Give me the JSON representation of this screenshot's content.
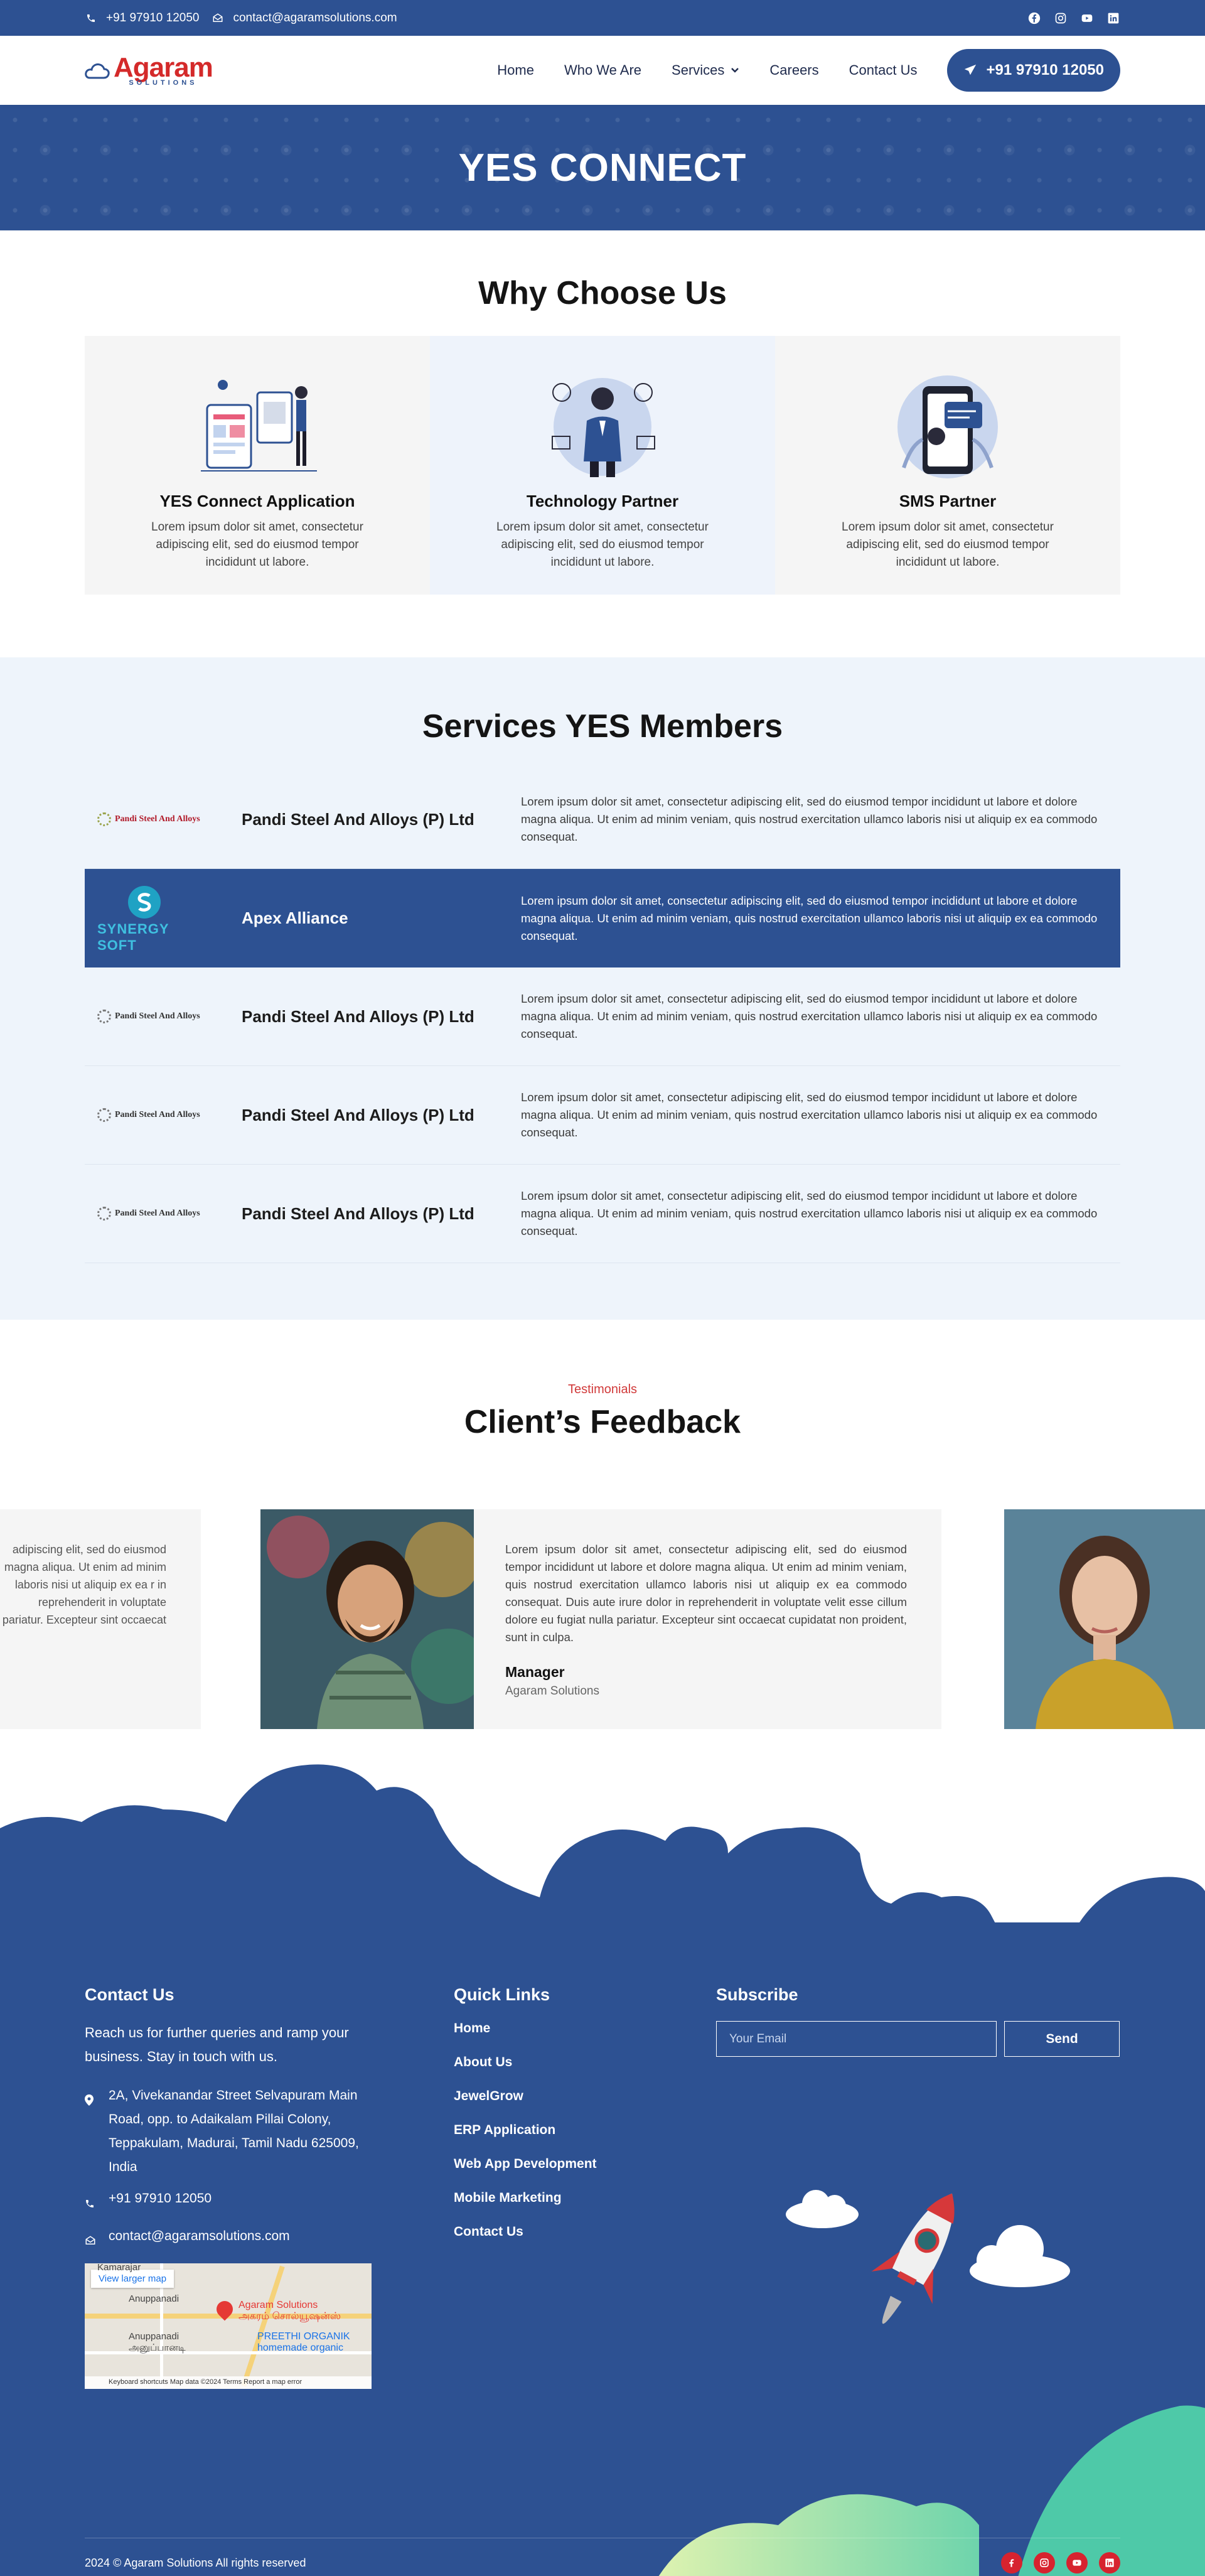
{
  "topbar": {
    "phone": "+91 97910 12050",
    "email": "contact@agaramsolutions.com",
    "social_icons": [
      "facebook-icon",
      "instagram-icon",
      "youtube-icon",
      "linkedin-icon"
    ]
  },
  "header": {
    "logo_text": "Agaram",
    "logo_sub": "SOLUTIONS",
    "nav": [
      "Home",
      "Who We Are",
      "Services",
      "Careers",
      "Contact Us"
    ],
    "phone_button": "+91 97910 12050"
  },
  "banner": {
    "title": "YES CONNECT"
  },
  "why": {
    "title": "Why Choose Us",
    "cards": [
      {
        "title": "YES Connect Application",
        "text": "Lorem ipsum dolor sit amet, consectetur adipiscing elit, sed do eiusmod tempor incididunt ut labore."
      },
      {
        "title": "Technology Partner",
        "text": "Lorem ipsum dolor sit amet, consectetur adipiscing elit, sed do eiusmod tempor incididunt ut labore."
      },
      {
        "title": "SMS Partner",
        "text": "Lorem ipsum dolor sit amet, consectetur adipiscing elit, sed do eiusmod tempor incididunt ut labore."
      }
    ]
  },
  "services": {
    "title": "Services YES Members",
    "rows": [
      {
        "name": "Pandi Steel And Alloys (P) Ltd",
        "logo": "Pandi Steel And Alloys",
        "text": "Lorem ipsum dolor sit amet, consectetur adipiscing elit, sed do eiusmod tempor incididunt ut labore et dolore magna aliqua. Ut enim ad minim veniam, quis nostrud exercitation ullamco laboris nisi ut aliquip ex ea commodo consequat.",
        "active": false
      },
      {
        "name": "Apex Alliance",
        "logo": "SYNERGY SOFT",
        "text": "Lorem ipsum dolor sit amet, consectetur adipiscing elit, sed do eiusmod tempor incididunt ut labore et dolore magna aliqua. Ut enim ad minim veniam, quis nostrud exercitation ullamco laboris nisi ut aliquip ex ea commodo consequat.",
        "active": true
      },
      {
        "name": "Pandi Steel And Alloys (P) Ltd",
        "logo": "Pandi Steel And Alloys",
        "text": "Lorem ipsum dolor sit amet, consectetur adipiscing elit, sed do eiusmod tempor incididunt ut labore et dolore magna aliqua. Ut enim ad minim veniam, quis nostrud exercitation ullamco laboris nisi ut aliquip ex ea commodo consequat.",
        "active": false
      },
      {
        "name": "Pandi Steel And Alloys (P) Ltd",
        "logo": "Pandi Steel And Alloys",
        "text": "Lorem ipsum dolor sit amet, consectetur adipiscing elit, sed do eiusmod tempor incididunt ut labore et dolore magna aliqua. Ut enim ad minim veniam, quis nostrud exercitation ullamco laboris nisi ut aliquip ex ea commodo consequat.",
        "active": false
      },
      {
        "name": "Pandi Steel And Alloys (P) Ltd",
        "logo": "Pandi Steel And Alloys",
        "text": "Lorem ipsum dolor sit amet, consectetur adipiscing elit, sed do eiusmod tempor incididunt ut labore et dolore magna aliqua. Ut enim ad minim veniam, quis nostrud exercitation ullamco laboris nisi ut aliquip ex ea commodo consequat.",
        "active": false
      }
    ]
  },
  "testimonials": {
    "tag": "Testimonials",
    "title": "Client’s Feedback",
    "prev_text": "adipiscing elit, sed do eiusmod magna aliqua. Ut enim ad minim laboris nisi ut aliquip ex ea r in reprehenderit in voluptate pariatur. Excepteur sint occaecat",
    "main_text": "Lorem ipsum dolor sit amet, consectetur adipiscing elit, sed do eiusmod tempor incididunt ut labore et dolore magna aliqua. Ut enim ad minim veniam, quis nostrud exercitation ullamco laboris nisi ut aliquip ex ea commodo consequat. Duis aute irure dolor in reprehenderit in voluptate velit esse cillum dolore eu fugiat nulla pariatur. Excepteur sint occaecat cupidatat non proident, sunt in culpa.",
    "role": "Manager",
    "company": "Agaram Solutions",
    "dots_total": 4,
    "dots_active": 3
  },
  "footer": {
    "contact_title": "Contact Us",
    "contact_intro": "Reach us for further queries and ramp your business. Stay in touch with us.",
    "address": "2A, Vivekanandar Street Selvapuram Main Road, opp. to Adaikalam Pillai Colony, Teppakulam, Madurai, Tamil Nadu 625009, India",
    "phone": "+91 97910 12050",
    "email": "contact@agaramsolutions.com",
    "map": {
      "link": "View larger map",
      "place1": "Agaram Solutions",
      "place1_sub": "அகரம் சொல்யூஷன்ஸ்",
      "place2": "PREETHI ORGANIK",
      "place2_sub": "homemade organic",
      "area1": "Anuppanadi",
      "area1_sub": "அனுப்பானடி",
      "area2": "Kamarajar",
      "footer_bar": "Keyboard shortcuts   Map data ©2024   Terms   Report a map error"
    },
    "links_title": "Quick Links",
    "links": [
      "Home",
      "About Us",
      "JewelGrow",
      "ERP Application",
      "Web App Development",
      "Mobile Marketing",
      "Contact Us"
    ],
    "subscribe_title": "Subscribe",
    "email_placeholder": "Your Email",
    "send_label": "Send",
    "copyright": "2024 © Agaram Solutions All rights reserved",
    "social_icons": [
      "facebook-icon",
      "instagram-icon",
      "youtube-icon",
      "linkedin-icon"
    ]
  },
  "colors": {
    "brand_blue": "#2d5192",
    "brand_red": "#d42a2a",
    "light_bg": "#eef4fb"
  }
}
